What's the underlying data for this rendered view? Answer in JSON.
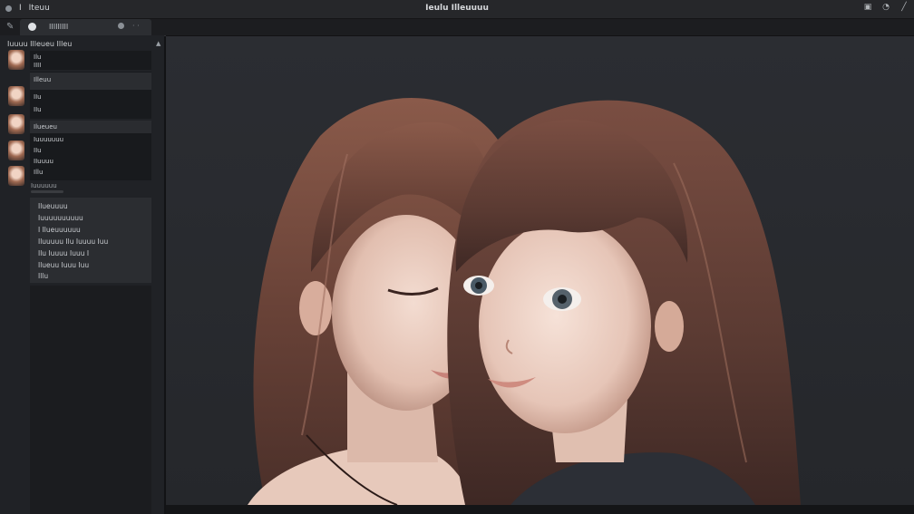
{
  "titlebar": {
    "menu_label": "Ⅰ",
    "menu_item": "Iteuu",
    "title": "Ieulu Illeuuuu",
    "icons": [
      "settings-icon",
      "globe-icon",
      "pen-icon"
    ]
  },
  "toolbar": {
    "tab_label": "IIIIIIIII"
  },
  "sidebar": {
    "header": "Iuuuu Illeueu Illeu",
    "panel1": [
      "Ilu",
      "IIII"
    ],
    "panel2": [
      "Illeuu",
      "IIu",
      "IIu"
    ],
    "panel3": [
      "Ilueueu",
      "Iuuuuuuu",
      "IIu",
      "IIuuuu",
      "Illu"
    ],
    "scroll_label": "Iuuuuuu",
    "panel4": [
      "Ilueuuuu",
      "Iuuuuuuuuuu",
      "I Ilueuuuuuu",
      "Iluuuuu Ilu Iuuuu Iuu",
      "Ilu Iuuuu Iuuu I",
      "Ilueuu Iuuu Iuu",
      "Illu"
    ]
  }
}
